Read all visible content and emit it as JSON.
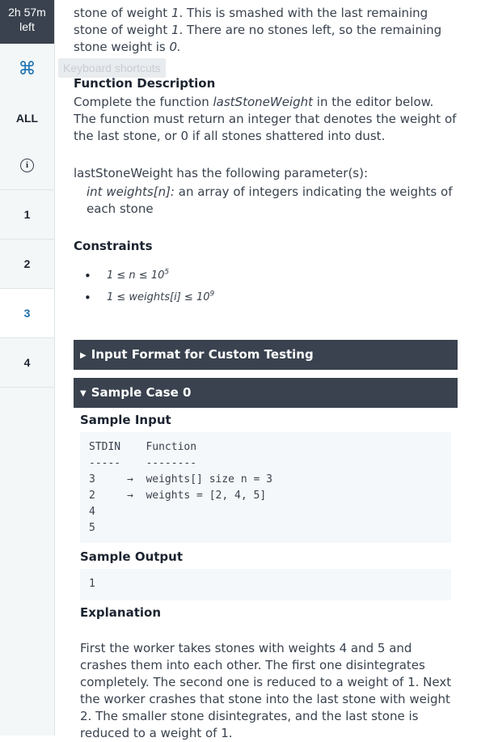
{
  "timer": {
    "line1": "2h 57m",
    "line2": "left"
  },
  "rail": {
    "shortcuts_icon": "⌘",
    "tooltip": "Keyboard shortcuts",
    "all_label": "ALL",
    "info_icon": "i",
    "questions": [
      "1",
      "2",
      "3",
      "4"
    ],
    "active_question": "3"
  },
  "problem": {
    "intro_line1": "stone of weight ",
    "intro_v1": "1",
    "intro_line1b": ". This is smashed with the last remaining stone of",
    "intro_line2": "weight ",
    "intro_v2": "1",
    "intro_line2b": ". There are no stones left, so the remaining stone weight is",
    "intro_v3": "0",
    "intro_end": ".",
    "func_desc_heading": "Function Description",
    "func_desc_1": "Complete the function ",
    "func_name": "lastStoneWeight",
    "func_desc_2": " in the editor below. The function must return an integer that denotes the weight of the last stone, or 0 if all stones shattered into dust.",
    "params_intro": "lastStoneWeight has the following parameter(s):",
    "param_name": "int weights[n]:",
    "param_desc": "  an array of integers indicating the weights of each stone",
    "constraints_heading": "Constraints",
    "constraint1": "1 ≤ n ≤ 10",
    "constraint1_exp": "5",
    "constraint2": "1 ≤ weights[i] ≤ 10",
    "constraint2_exp": "9"
  },
  "input_format": {
    "label": "Input Format for Custom Testing",
    "expanded": false
  },
  "sample_case": {
    "label": "Sample Case 0",
    "expanded": true,
    "input_heading": "Sample Input",
    "input_lines": [
      "STDIN    Function",
      "-----    --------",
      "3     →  weights[] size n = 3",
      "2     →  weights = [2, 4, 5]",
      "4",
      "5"
    ],
    "output_heading": "Sample Output",
    "output_value": "1",
    "explanation_heading": "Explanation",
    "explanation": "First the worker takes stones with weights 4 and 5 and crashes them into each other. The first one disintegrates completely. The second one is reduced to a weight of 1. Next the worker crashes that stone into the last stone with weight 2. The smaller stone disintegrates, and the last stone is reduced to a weight of 1."
  }
}
